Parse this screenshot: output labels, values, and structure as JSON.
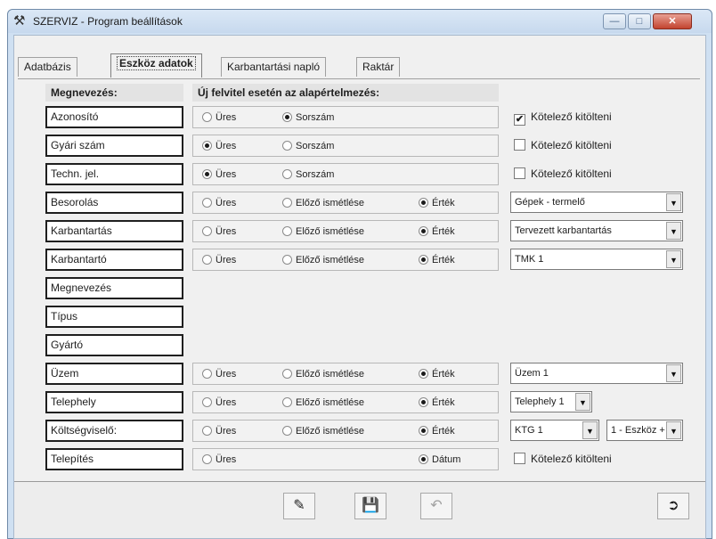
{
  "window": {
    "title": "SZERVIZ - Program beállítások"
  },
  "tabs": [
    {
      "label": "Adatbázis"
    },
    {
      "label": "Eszköz adatok"
    },
    {
      "label": "Karbantartási napló"
    },
    {
      "label": "Raktár"
    }
  ],
  "headers": {
    "name_col": "Megnevezés:",
    "default_col": "Új felvitel esetén az alapértelmezés:"
  },
  "radio_labels": {
    "empty": "Üres",
    "serial": "Sorszám",
    "repeat": "Előző ismétlése",
    "value": "Érték",
    "date": "Dátum"
  },
  "rows": [
    {
      "label": "Azonosító",
      "selected": "serial",
      "required": {
        "label": "Kötelező kitölteni",
        "checked": true
      }
    },
    {
      "label": "Gyári szám",
      "selected": "empty",
      "required": {
        "label": "Kötelező kitölteni",
        "checked": false
      }
    },
    {
      "label": "Techn. jel.",
      "selected": "empty",
      "required": {
        "label": "Kötelező kitölteni",
        "checked": false
      }
    },
    {
      "label": "Besorolás",
      "selected": "value",
      "dropdown": "Gépek - termelő"
    },
    {
      "label": "Karbantartás",
      "selected": "value",
      "dropdown": "Tervezett karbantartás"
    },
    {
      "label": "Karbantartó",
      "selected": "value",
      "dropdown": "TMK 1"
    },
    {
      "label": "Megnevezés"
    },
    {
      "label": "Típus"
    },
    {
      "label": "Gyártó"
    },
    {
      "label": "Üzem",
      "selected": "value",
      "dropdown": "Üzem 1"
    },
    {
      "label": "Telephely",
      "selected": "value",
      "dropdown": "Telephely 1"
    },
    {
      "label": "Költségviselő:",
      "selected": "value",
      "dropdown": "KTG 1",
      "dropdown2": "1 - Eszköz +"
    },
    {
      "label": "Telepítés",
      "selected": "date",
      "required": {
        "label": "Kötelező kitölteni",
        "checked": false
      }
    }
  ],
  "toolbar": {
    "buttons": [
      {
        "icon": "edit-form-icon"
      },
      {
        "icon": "save-icon"
      },
      {
        "icon": "undo-icon"
      },
      {
        "icon": "exit-door-icon"
      }
    ]
  }
}
